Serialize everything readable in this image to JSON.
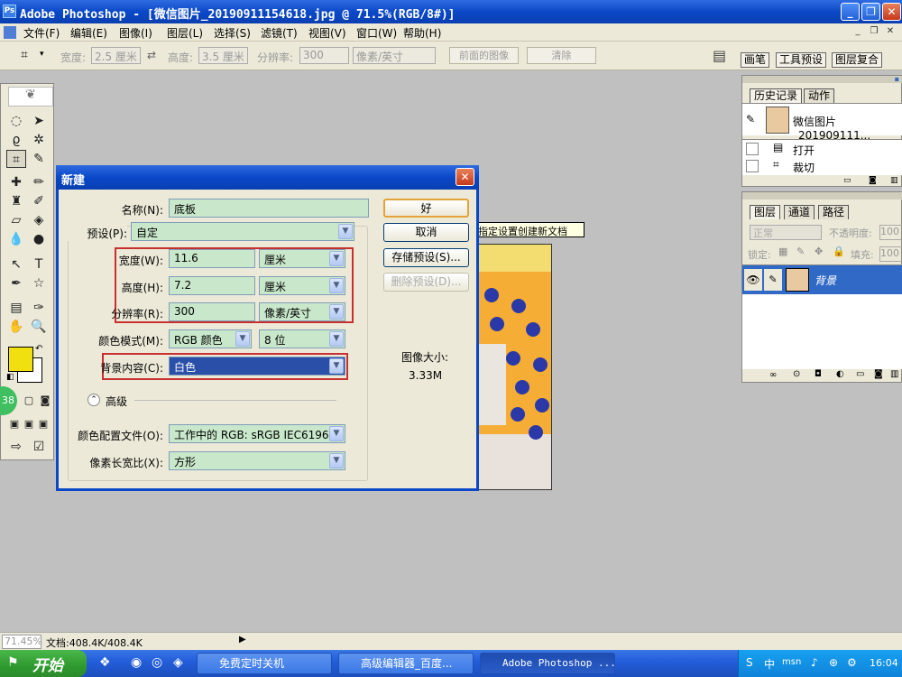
{
  "window": {
    "title": "Adobe Photoshop - [微信图片_20190911154618.jpg @ 71.5%(RGB/8#)]"
  },
  "menu": [
    "文件(F)",
    "编辑(E)",
    "图像(I)",
    "图层(L)",
    "选择(S)",
    "滤镜(T)",
    "视图(V)",
    "窗口(W)",
    "帮助(H)"
  ],
  "options": {
    "width_label": "宽度:",
    "width_value": "2.5 厘米",
    "height_label": "高度:",
    "height_value": "3.5 厘米",
    "res_label": "分辨率:",
    "res_value": "300",
    "res_unit": "像素/英寸",
    "front_image_btn": "前面的图像",
    "clear_btn": "清除"
  },
  "palette_well": [
    "画笔",
    "工具预设",
    "图层复合"
  ],
  "dialog": {
    "title": "新建",
    "name_label": "名称(N):",
    "name_value": "底板",
    "preset_label": "预设(P):",
    "preset_value": "自定",
    "width_label": "宽度(W):",
    "width_value": "11.6",
    "width_unit": "厘米",
    "height_label": "高度(H):",
    "height_value": "7.2",
    "height_unit": "厘米",
    "res_label": "分辨率(R):",
    "res_value": "300",
    "res_unit": "像素/英寸",
    "mode_label": "颜色模式(M):",
    "mode_value": "RGB 颜色",
    "bitdepth_value": "8 位",
    "bg_label": "背景内容(C):",
    "bg_value": "白色",
    "advanced_label": "高级",
    "profile_label": "颜色配置文件(O):",
    "profile_value": "工作中的 RGB: sRGB IEC6196...",
    "aspect_label": "像素长宽比(X):",
    "aspect_value": "方形",
    "ok_btn": "好",
    "cancel_btn": "取消",
    "save_preset_btn": "存储预设(S)...",
    "delete_preset_btn": "删除预设(D)...",
    "size_label": "图像大小:",
    "size_value": "3.33M",
    "tooltip": "使用指定设置创建新文档"
  },
  "history_panel": {
    "tabs": [
      "历史记录",
      "动作"
    ],
    "snapshot": "微信图片_201909111...",
    "items": [
      "打开",
      "裁切"
    ]
  },
  "layers_panel": {
    "tabs": [
      "图层",
      "通道",
      "路径"
    ],
    "blend_mode": "正常",
    "opacity_label": "不透明度:",
    "opacity_value": "100",
    "lock_label": "锁定:",
    "fill_label": "填充:",
    "fill_value": "100",
    "layer_name": "背景"
  },
  "status": {
    "zoom": "71.45%",
    "doc": "文档:408.4K/408.4K"
  },
  "taskbar": {
    "start": "开始",
    "tasks": [
      "免费定时关机",
      "高级编辑器_百度...",
      "Adobe Photoshop ..."
    ],
    "clock": "16:04",
    "tray_ime": "中",
    "tray_misc": "msn"
  },
  "colors": {
    "foreground": "#f0e010",
    "background": "#ffffff",
    "accent": "#0a48c8"
  }
}
